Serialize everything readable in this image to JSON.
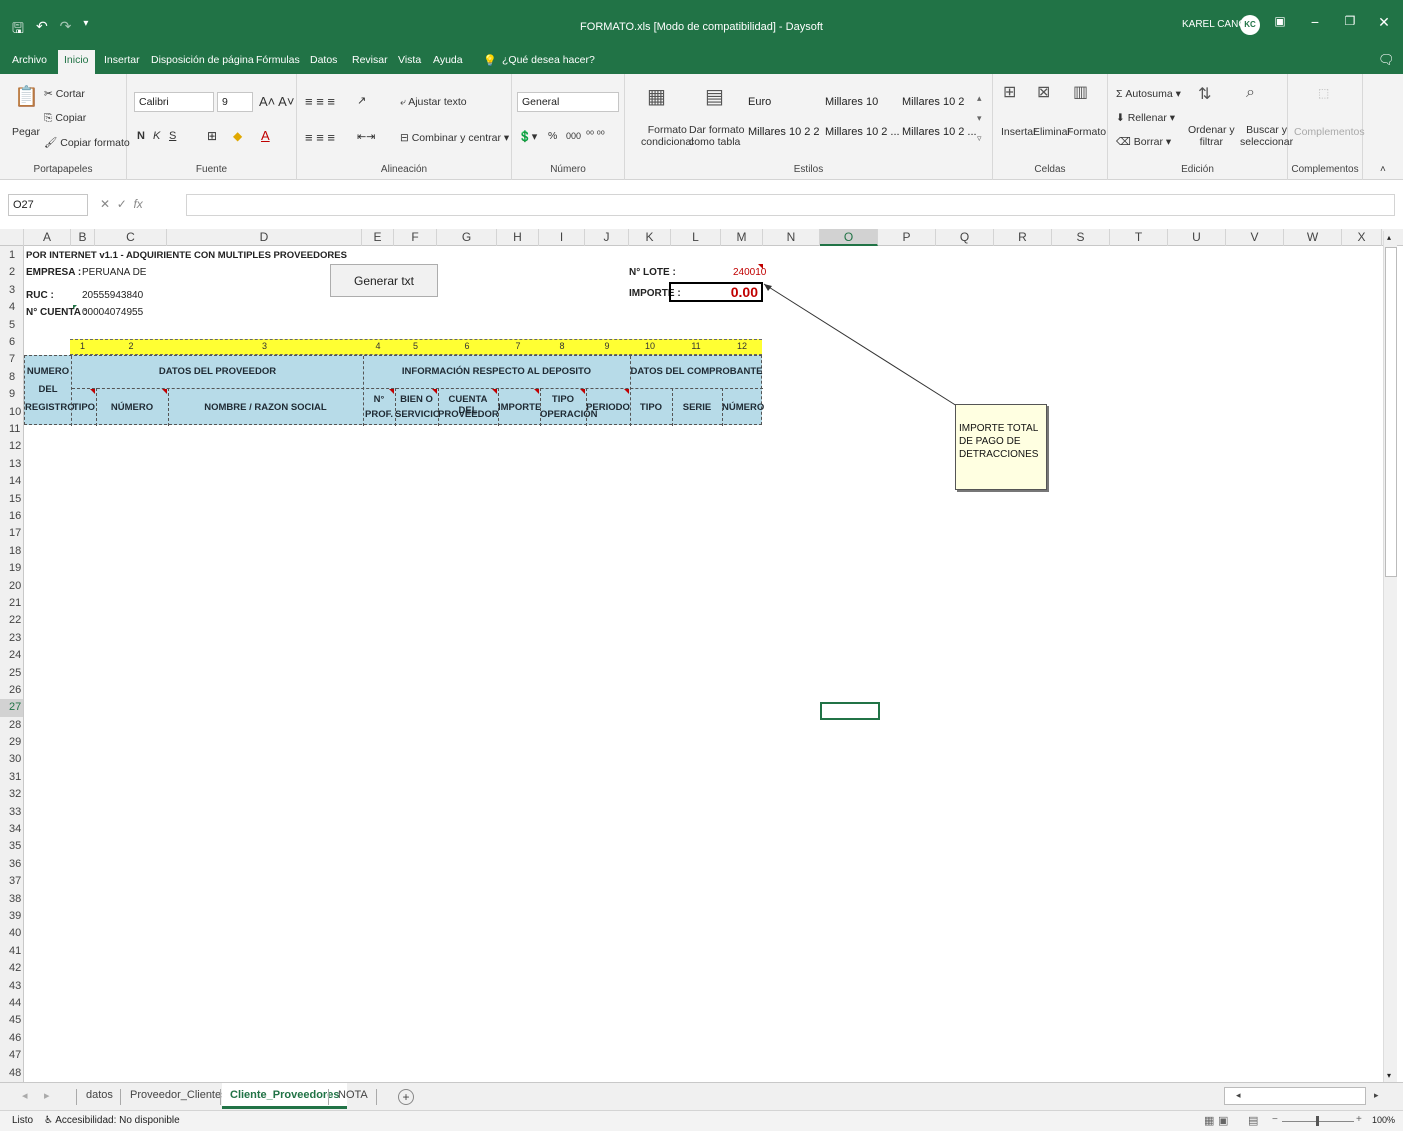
{
  "window": {
    "title": "FORMATO.xls [Modo de compatibilidad] - Daysoft",
    "user": "KAREL CANO",
    "avatar_initials": "KC",
    "minimize": "−",
    "restore": "❐",
    "close": "✕"
  },
  "ribbon_tabs": [
    "Archivo",
    "Inicio",
    "Insertar",
    "Disposición de página",
    "Fórmulas",
    "Datos",
    "Revisar",
    "Vista",
    "Ayuda",
    "¿Qué desea hacer?"
  ],
  "ribbon": {
    "clipboard": {
      "paste": "Pegar",
      "cut": "Cortar",
      "copy": "Copiar",
      "format_painter": "Copiar formato",
      "label": "Portapapeles"
    },
    "font": {
      "name": "Calibri",
      "size": "9",
      "bold": "N",
      "italic": "K",
      "underline": "S",
      "label": "Fuente"
    },
    "alignment": {
      "wrap": "Ajustar texto",
      "merge": "Combinar y centrar",
      "label": "Alineación"
    },
    "number": {
      "format": "General",
      "percent": "%",
      "thousands": "000",
      "label": "Número"
    },
    "styles": {
      "cond_format": [
        "Formato",
        "condicional"
      ],
      "as_table": [
        "Dar formato",
        "como tabla"
      ],
      "items": [
        "Euro",
        "Millares 10",
        "Millares 10 2",
        "Millares 10 2 2",
        "Millares 10 2 ...",
        "Millares 10 2 ..."
      ],
      "label": "Estilos"
    },
    "cells": {
      "insert": "Insertar",
      "delete": "Eliminar",
      "format": "Formato",
      "label": "Celdas"
    },
    "editing": {
      "autosum": "Autosuma",
      "fill": "Rellenar",
      "clear": "Borrar",
      "sort": [
        "Ordenar y",
        "filtrar"
      ],
      "find": [
        "Buscar y",
        "seleccionar"
      ],
      "label": "Edición"
    },
    "addins": {
      "button": "Complementos",
      "label": "Complementos"
    }
  },
  "formula_bar": {
    "name_box": "O27",
    "fx": "fx",
    "value": ""
  },
  "columns": [
    "A",
    "B",
    "C",
    "D",
    "E",
    "F",
    "G",
    "H",
    "I",
    "J",
    "K",
    "L",
    "M",
    "N",
    "O",
    "P",
    "Q",
    "R",
    "S",
    "T",
    "U",
    "V",
    "W",
    "X"
  ],
  "rows": [
    "1",
    "2",
    "3",
    "4",
    "5",
    "6",
    "7",
    "8",
    "9",
    "10",
    "11",
    "12",
    "13",
    "14",
    "15",
    "16",
    "17",
    "18",
    "19",
    "20",
    "21",
    "22",
    "23",
    "24",
    "25",
    "26",
    "27",
    "28",
    "29",
    "30",
    "31",
    "32",
    "33",
    "34",
    "35",
    "36",
    "37",
    "38",
    "39",
    "40",
    "41",
    "42",
    "43",
    "44",
    "45",
    "46",
    "47",
    "48"
  ],
  "sheet": {
    "title": "POR INTERNET v1.1 - ADQUIRIENTE CON MULTIPLES PROVEEDORES",
    "empresa_label": "EMPRESA :",
    "empresa_value": "PERUANA DE",
    "ruc_label": "RUC :",
    "ruc_value": "20555943840",
    "cuenta_label": "N° CUENTA :",
    "cuenta_value": "00004074955",
    "lote_label": "N° LOTE :",
    "lote_value": "240010",
    "importe_label": "IMPORTE :",
    "importe_value": "0.00",
    "generate_button": "Generar txt",
    "yellow_numbers": [
      "1",
      "2",
      "3",
      "4",
      "5",
      "6",
      "7",
      "8",
      "9",
      "10",
      "11",
      "12"
    ],
    "header": {
      "numero": "NUMERO",
      "del": "DEL",
      "registro": "REGISTRO",
      "datos_proveedor": "DATOS DEL PROVEEDOR",
      "info_deposito": "INFORMACIÓN RESPECTO AL DEPOSITO",
      "datos_comprobante": "DATOS DEL COMPROBANTE",
      "tipo": "TIPO",
      "numero_col": "NÚMERO",
      "nombre": "NOMBRE / RAZON SOCIAL",
      "nprof_1": "N°",
      "nprof_2": "PROF.",
      "bien_1": "BIEN O",
      "bien_2": "SERVICIO",
      "cuenta_1": "CUENTA DEL",
      "cuenta_2": "PROVEEDOR",
      "importe": "IMPORTE",
      "tipo_op_1": "TIPO",
      "tipo_op_2": "OPERACIÓN",
      "periodo": "PERIODO",
      "tipo_comp": "TIPO",
      "serie": "SERIE",
      "numero_comp": "NÚMERO"
    },
    "note": "IMPORTE TOTAL DE PAGO DE DETRACCIONES"
  },
  "sheet_tabs": [
    "datos",
    "Proveedor_Clientes",
    "Cliente_Proveedores",
    "NOTA"
  ],
  "active_sheet": "Cliente_Proveedores",
  "add_sheet": "+",
  "status": {
    "ready": "Listo",
    "accessibility": "Accesibilidad: No disponible",
    "zoom": "100%"
  },
  "colors": {
    "excel_green": "#217346",
    "yellow_band": "#ffff33",
    "header_blue": "#b7dbe8",
    "red": "#c00000"
  }
}
